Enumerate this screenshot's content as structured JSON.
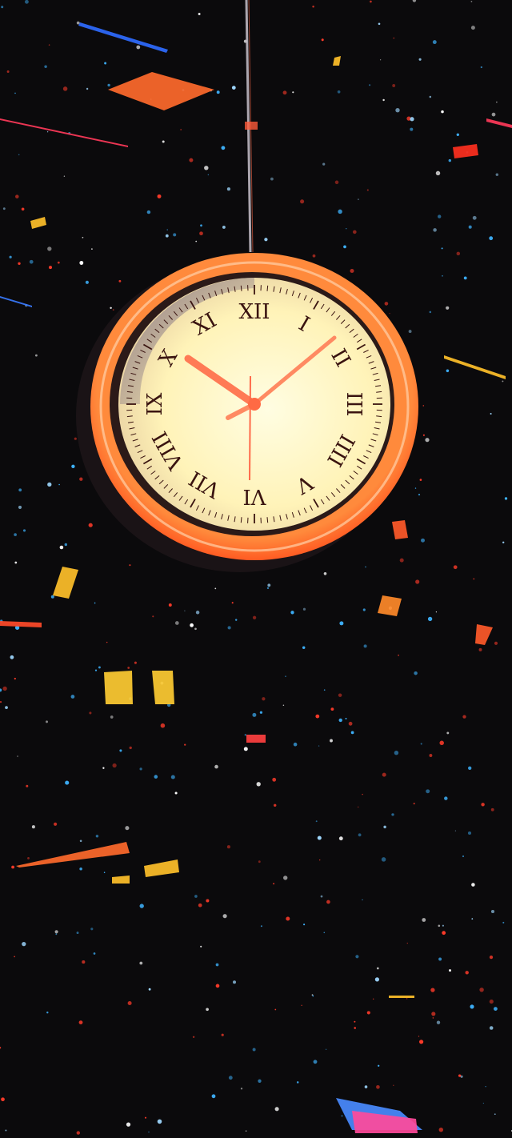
{
  "scene": {
    "subject": "wall-clock",
    "colors": {
      "background": "#0b0a0c",
      "rim": "#ff6a2c",
      "rim_highlight": "#ffc9a0",
      "face": "#fff6c4",
      "face_shadow": "#b9a49a",
      "numerals": "#3a1410",
      "hands": "#ff7a55",
      "star_blue": "#3fb4ff",
      "star_red": "#ff3b2a",
      "accent_yellow": "#ffc02a"
    },
    "clock": {
      "numerals": [
        "XII",
        "I",
        "II",
        "III",
        "IIII",
        "V",
        "VI",
        "VII",
        "VIII",
        "IX",
        "X",
        "XI"
      ],
      "time_shown": "10:10"
    }
  }
}
